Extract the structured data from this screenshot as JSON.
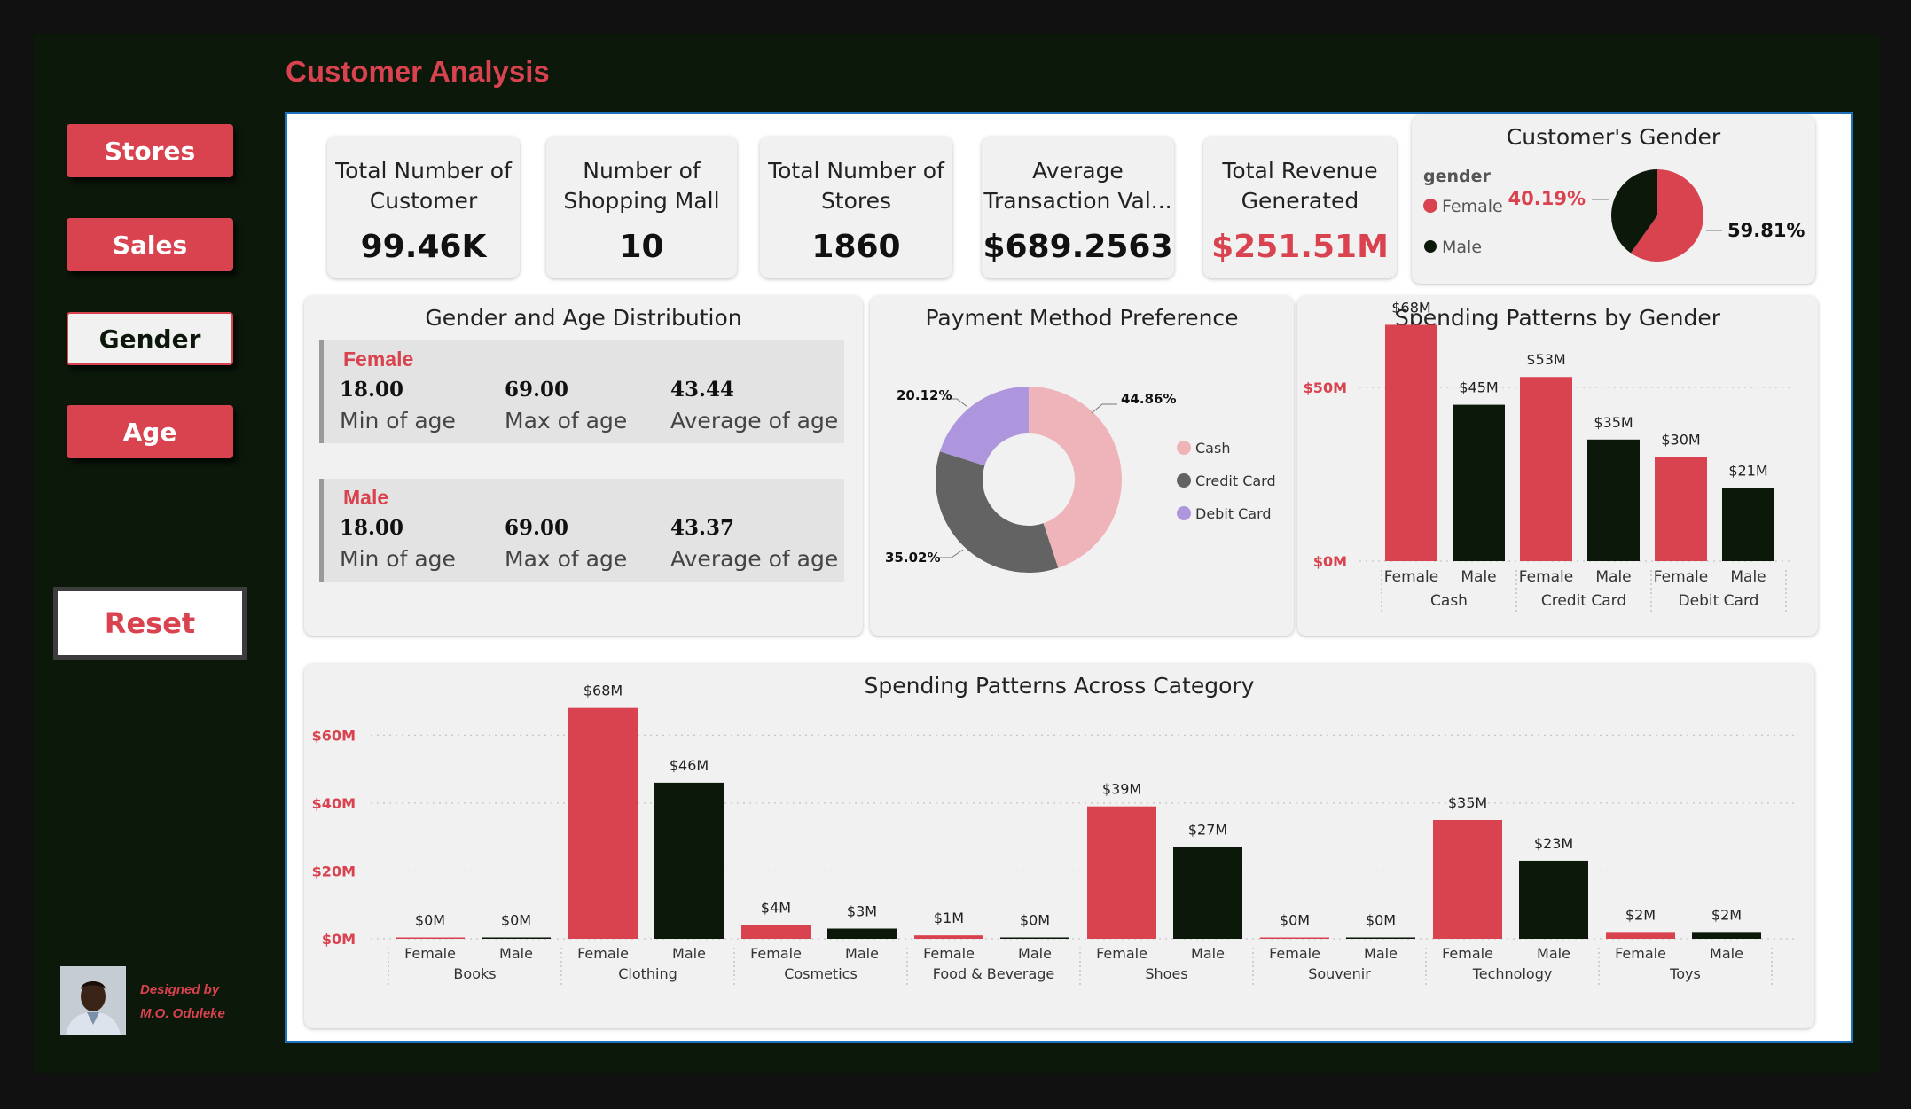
{
  "app": {
    "title": "Customer Analysis"
  },
  "nav": {
    "stores": "Stores",
    "sales": "Sales",
    "gender": "Gender",
    "age": "Age",
    "reset": "Reset"
  },
  "credit": {
    "line1": "Designed by",
    "line2": "M.O. Oduleke"
  },
  "kpis": [
    {
      "label1": "Total Number of",
      "label2": "Customer",
      "value": "99.46K",
      "color": "#111111"
    },
    {
      "label1": "Number of",
      "label2": "Shopping Mall",
      "value": "10",
      "color": "#111111"
    },
    {
      "label1": "Total Number of",
      "label2": "Stores",
      "value": "1860",
      "color": "#111111"
    },
    {
      "label1": "Average",
      "label2": "Transaction Val...",
      "value": "$689.2563",
      "color": "#111111"
    },
    {
      "label1": "Total Revenue",
      "label2": "Generated",
      "value": "$251.51M",
      "color": "#d9424f"
    }
  ],
  "gender_card": {
    "title": "Customer's Gender",
    "legend_title": "gender",
    "female": "Female",
    "male": "Male"
  },
  "age_card": {
    "title": "Gender and Age Distribution",
    "female": {
      "name": "Female",
      "min": "18.00",
      "max": "69.00",
      "avg": "43.44"
    },
    "male": {
      "name": "Male",
      "min": "18.00",
      "max": "69.00",
      "avg": "43.37"
    },
    "min_label": "Min of age",
    "max_label": "Max of age",
    "avg_label": "Average of age"
  },
  "colors": {
    "accent": "#d9424f",
    "dark": "#0b180a",
    "cash": "#efb4b9",
    "credit": "#636363",
    "debit": "#ae96de",
    "border": "#1e72bd"
  },
  "chart_data": [
    {
      "id": "gender_pie",
      "type": "pie",
      "title": "Customer's Gender",
      "slices": [
        {
          "name": "Female",
          "value": 59.81,
          "label": "59.81%"
        },
        {
          "name": "Male",
          "value": 40.19,
          "label": "40.19%"
        }
      ]
    },
    {
      "id": "payment_donut",
      "type": "pie",
      "title": "Payment Method Preference",
      "slices": [
        {
          "name": "Cash",
          "value": 44.86,
          "label": "44.86%"
        },
        {
          "name": "Credit Card",
          "value": 35.02,
          "label": "35.02%"
        },
        {
          "name": "Debit Card",
          "value": 20.12,
          "label": "20.12%"
        }
      ]
    },
    {
      "id": "spend_gender",
      "type": "bar",
      "title": "Spending Patterns by Gender",
      "groups": [
        "Cash",
        "Credit Card",
        "Debit Card"
      ],
      "sub": [
        "Female",
        "Male"
      ],
      "values": [
        [
          68,
          45
        ],
        [
          53,
          35
        ],
        [
          30,
          21
        ]
      ],
      "labels": [
        [
          "$68M",
          "$45M"
        ],
        [
          "$53M",
          "$35M"
        ],
        [
          "$30M",
          "$21M"
        ]
      ],
      "yticks": [
        "$0M",
        "$50M"
      ],
      "ylim": [
        0,
        70
      ]
    },
    {
      "id": "spend_category",
      "type": "bar",
      "title": "Spending Patterns Across Category",
      "groups": [
        "Books",
        "Clothing",
        "Cosmetics",
        "Food & Beverage",
        "Shoes",
        "Souvenir",
        "Technology",
        "Toys"
      ],
      "sub": [
        "Female",
        "Male"
      ],
      "values": [
        [
          0.4,
          0.4
        ],
        [
          68,
          46
        ],
        [
          4,
          3
        ],
        [
          1,
          0.4
        ],
        [
          39,
          27
        ],
        [
          0.4,
          0.4
        ],
        [
          35,
          23
        ],
        [
          2,
          2
        ]
      ],
      "labels": [
        [
          "$0M",
          "$0M"
        ],
        [
          "$68M",
          "$46M"
        ],
        [
          "$4M",
          "$3M"
        ],
        [
          "$1M",
          "$0M"
        ],
        [
          "$39M",
          "$27M"
        ],
        [
          "$0M",
          "$0M"
        ],
        [
          "$35M",
          "$23M"
        ],
        [
          "$2M",
          "$2M"
        ]
      ],
      "yticks": [
        "$0M",
        "$20M",
        "$40M",
        "$60M"
      ],
      "ylim": [
        0,
        70
      ]
    }
  ]
}
